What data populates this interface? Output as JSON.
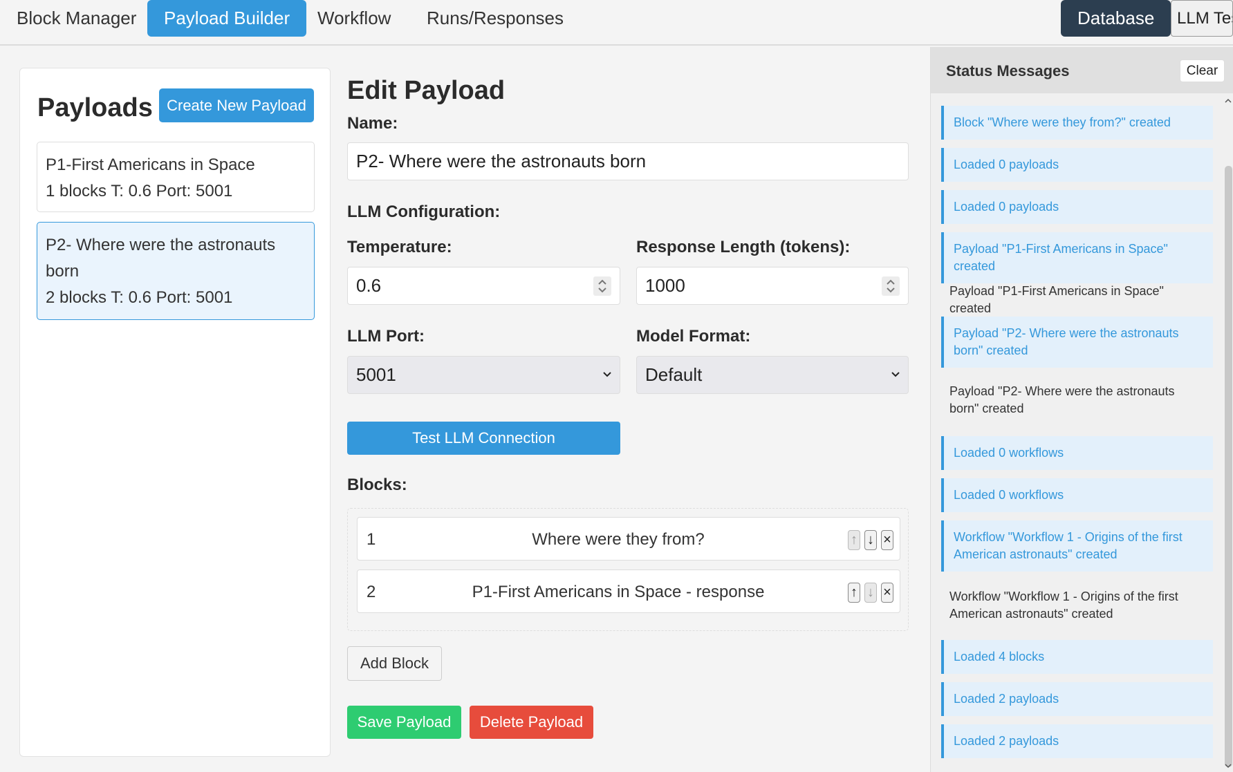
{
  "nav": {
    "tabs": [
      {
        "label": "Block Manager"
      },
      {
        "label": "Payload Builder"
      },
      {
        "label": "Workflow"
      },
      {
        "label": "Runs/Responses"
      }
    ],
    "database": "Database",
    "llm_tester": "LLM Teste"
  },
  "payloads": {
    "title": "Payloads",
    "create_label": "Create New Payload",
    "items": [
      {
        "name": "P1-First Americans in Space",
        "meta": "1 blocks T: 0.6 Port: 5001"
      },
      {
        "name": "P2- Where were the astronauts born",
        "meta": "2 blocks T: 0.6 Port: 5001"
      }
    ]
  },
  "editor": {
    "title": "Edit Payload",
    "name_label": "Name:",
    "name_value": "P2- Where were the astronauts born",
    "llm_config_label": "LLM Configuration:",
    "temperature_label": "Temperature:",
    "temperature_value": "0.6",
    "response_length_label": "Response Length (tokens):",
    "response_length_value": "1000",
    "port_label": "LLM Port:",
    "port_value": "5001",
    "model_format_label": "Model Format:",
    "model_format_value": "Default",
    "test_label": "Test LLM Connection",
    "blocks_label": "Blocks:",
    "blocks": [
      {
        "num": "1",
        "text": "Where were they from?"
      },
      {
        "num": "2",
        "text": "P1-First Americans in Space - response"
      }
    ],
    "up_glyph": "↑",
    "down_glyph": "↓",
    "remove_glyph": "×",
    "add_block_label": "Add Block",
    "save_label": "Save Payload",
    "delete_label": "Delete Payload"
  },
  "status": {
    "title": "Status Messages",
    "clear_label": "Clear",
    "messages": [
      {
        "text": "Block \"Where were they from?\" created",
        "type": "info"
      },
      {
        "text": "Loaded 0 payloads",
        "type": "info"
      },
      {
        "text": "Loaded 0 payloads",
        "type": "info"
      },
      {
        "text": "Payload \"P1-First Americans in Space\" created",
        "type": "info"
      },
      {
        "text": "Payload \"P1-First Americans in Space\" created",
        "type": "plain"
      },
      {
        "text": "Payload \"P2- Where were the astronauts born\" created",
        "type": "info"
      },
      {
        "text": "Payload \"P2- Where were the astronauts born\" created",
        "type": "plain"
      },
      {
        "text": "Loaded 0 workflows",
        "type": "info"
      },
      {
        "text": "Loaded 0 workflows",
        "type": "info"
      },
      {
        "text": "Workflow \"Workflow 1 - Origins of the first American astronauts\" created",
        "type": "info"
      },
      {
        "text": "Workflow \"Workflow 1 - Origins of the first American astronauts\" created",
        "type": "plain"
      },
      {
        "text": "Loaded 4 blocks",
        "type": "info"
      },
      {
        "text": "Loaded 2 payloads",
        "type": "info"
      },
      {
        "text": "Loaded 2 payloads",
        "type": "info"
      }
    ]
  },
  "colors": {
    "accent": "#3498db",
    "dark": "#2c3e50",
    "success": "#2ecc71",
    "danger": "#e74c3c"
  }
}
